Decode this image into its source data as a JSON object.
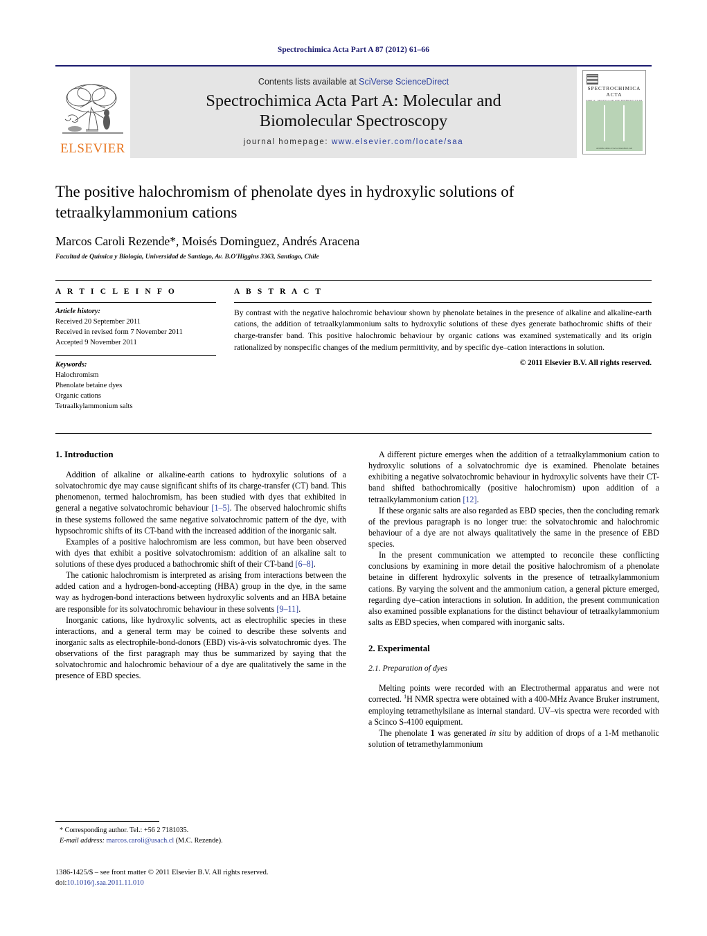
{
  "running_head": "Spectrochimica Acta Part A 87 (2012) 61–66",
  "masthead": {
    "contents_prefix": "Contents lists available at ",
    "contents_link": "SciVerse ScienceDirect",
    "journal_title_line1": "Spectrochimica Acta Part A: Molecular and",
    "journal_title_line2": "Biomolecular Spectroscopy",
    "homepage_label": "journal homepage:",
    "homepage_url": "www.elsevier.com/locate/saa",
    "publisher_logo_text": "ELSEVIER",
    "cover": {
      "title_line1": "SPECTROCHIMICA",
      "title_line2": "ACTA",
      "subtitle": "PART A : MOLECULAR AND BIOMOLECULAR SPECTROSCOPY",
      "footer": "Available online at www.sciencedirect.com"
    }
  },
  "article": {
    "title": "The positive halochromism of phenolate dyes in hydroxylic solutions of tetraalkylammonium cations",
    "authors": "Marcos Caroli Rezende*, Moisés Dominguez, Andrés Aracena",
    "affiliation": "Facultad de Química y Biología, Universidad de Santiago, Av. B.O'Higgins 3363, Santiago, Chile"
  },
  "article_info": {
    "heading": "A R T I C L E    I N F O",
    "history_label": "Article history:",
    "history": [
      "Received 20 September 2011",
      "Received in revised form 7 November 2011",
      "Accepted 9 November 2011"
    ],
    "keywords_label": "Keywords:",
    "keywords": [
      "Halochromism",
      "Phenolate betaine dyes",
      "Organic cations",
      "Tetraalkylammonium salts"
    ]
  },
  "abstract": {
    "heading": "A B S T R A C T",
    "text": "By contrast with the negative halochromic behaviour shown by phenolate betaines in the presence of alkaline and alkaline-earth cations, the addition of tetraalkylammonium salts to hydroxylic solutions of these dyes generate bathochromic shifts of their charge-transfer band. This positive halochromic behaviour by organic cations was examined systematically and its origin rationalized by nonspecific changes of the medium permittivity, and by specific dye–cation interactions in solution.",
    "copyright": "© 2011 Elsevier B.V. All rights reserved."
  },
  "sections": {
    "introduction_heading": "1.  Introduction",
    "experimental_heading": "2.  Experimental",
    "preparation_heading": "2.1.  Preparation of dyes"
  },
  "left_column": {
    "p1_a": "Addition of alkaline or alkaline-earth cations to hydroxylic solutions of a solvatochromic dye may cause significant shifts of its charge-transfer (CT) band. This phenomenon, termed halochromism, has been studied with dyes that exhibited in general a negative solvatochromic behaviour ",
    "p1_ref": "[1–5]",
    "p1_b": ". The observed halochromic shifts in these systems followed the same negative solvatochromic pattern of the dye, with hypsochromic shifts of its CT-band with the increased addition of the inorganic salt.",
    "p2_a": "Examples of a positive halochromism are less common, but have been observed with dyes that exhibit a positive solvatochromism: addition of an alkaline salt to solutions of these dyes produced a bathochromic shift of their CT-band ",
    "p2_ref": "[6–8]",
    "p2_b": ".",
    "p3_a": "The cationic halochromism is interpreted as arising from interactions between the added cation and a hydrogen-bond-accepting (HBA) group in the dye, in the same way as hydrogen-bond interactions between hydroxylic solvents and an HBA betaine are responsible for its solvatochromic behaviour in these solvents ",
    "p3_ref": "[9–11]",
    "p3_b": ".",
    "p4": "Inorganic cations, like hydroxylic solvents, act as electrophilic species in these interactions, and a general term may be coined to describe these solvents and inorganic salts as electrophile-bond-donors (EBD) vis-à-vis solvatochromic dyes. The observations of the first paragraph may thus be summarized by saying that the solvatochromic and halochromic behaviour of a dye are qualitatively the same in the presence of EBD species."
  },
  "right_column": {
    "p1_a": "A different picture emerges when the addition of a tetraalkylammonium cation to hydroxylic solutions of a solvatochromic dye is examined. Phenolate betaines exhibiting a negative solvatochromic behaviour in hydroxylic solvents have their CT-band shifted bathochromically (positive halochromism) upon addition of a tetraalkylammonium cation ",
    "p1_ref": "[12]",
    "p1_b": ".",
    "p2": "If these organic salts are also regarded as EBD species, then the concluding remark of the previous paragraph is no longer true: the solvatochromic and halochromic behaviour of a dye are not always qualitatively the same in the presence of EBD species.",
    "p3": "In the present communication we attempted to reconcile these conflicting conclusions by examining in more detail the positive halochromism of a phenolate betaine in different hydroxylic solvents in the presence of tetraalkylammonium cations. By varying the solvent and the ammonium cation, a general picture emerged, regarding dye–cation interactions in solution. In addition, the present communication also examined possible explanations for the distinct behaviour of tetraalkylammonium salts as EBD species, when compared with inorganic salts.",
    "p4_a": "Melting points were recorded with an Electrothermal apparatus and were not corrected. ",
    "p4_sup": "1",
    "p4_b": "H NMR spectra were obtained with a 400-MHz Avance Bruker instrument, employing tetramethylsilane as internal standard. UV–vis spectra were recorded with a Scinco S-4100 equipment.",
    "p5_a": "The phenolate ",
    "p5_bold": "1",
    "p5_b": " was generated ",
    "p5_ital": "in situ",
    "p5_c": " by addition of drops of a 1-M methanolic solution of tetramethylammonium"
  },
  "footnote": {
    "corresponding": "* Corresponding author. Tel.: +56 2 7181035.",
    "email_label": "E-mail address:",
    "email": "marcos.caroli@usach.cl",
    "email_suffix": " (M.C. Rezende)."
  },
  "imprint": {
    "line1": "1386-1425/$ – see front matter © 2011 Elsevier B.V. All rights reserved.",
    "doi_label": "doi:",
    "doi_value": "10.1016/j.saa.2011.11.010"
  },
  "colors": {
    "link_blue": "#2b3f9e",
    "header_navy": "#1a1a6e",
    "elsevier_orange": "#e87722",
    "masthead_grey": "#e5e5e5",
    "cover_green": "#b9d3b6"
  }
}
